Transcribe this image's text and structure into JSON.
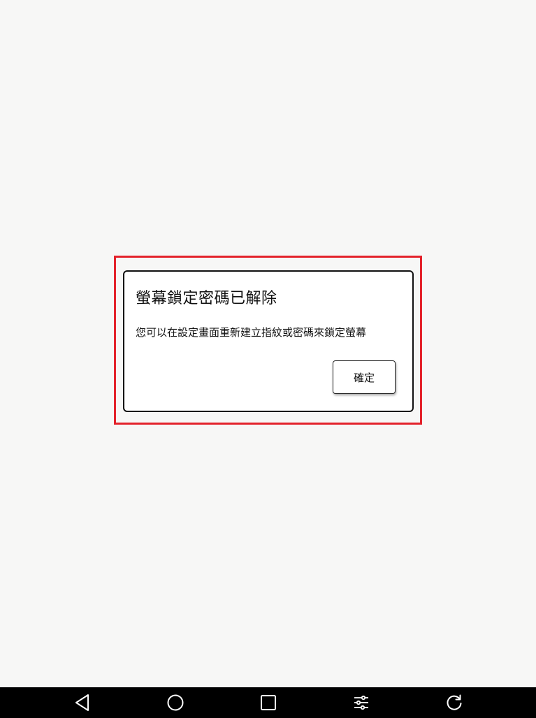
{
  "dialog": {
    "title": "螢幕鎖定密碼已解除",
    "message": "您可以在設定畫面重新建立指紋或密碼來鎖定螢幕",
    "ok_label": "確定"
  },
  "highlight": {
    "color": "#e3222b"
  },
  "navbar": {
    "background": "#000000",
    "buttons": [
      {
        "name": "back",
        "icon": "back-triangle-icon"
      },
      {
        "name": "home",
        "icon": "home-circle-icon"
      },
      {
        "name": "recents",
        "icon": "recents-square-icon"
      },
      {
        "name": "settings",
        "icon": "sliders-icon"
      },
      {
        "name": "rotate",
        "icon": "rotate-icon"
      }
    ]
  }
}
